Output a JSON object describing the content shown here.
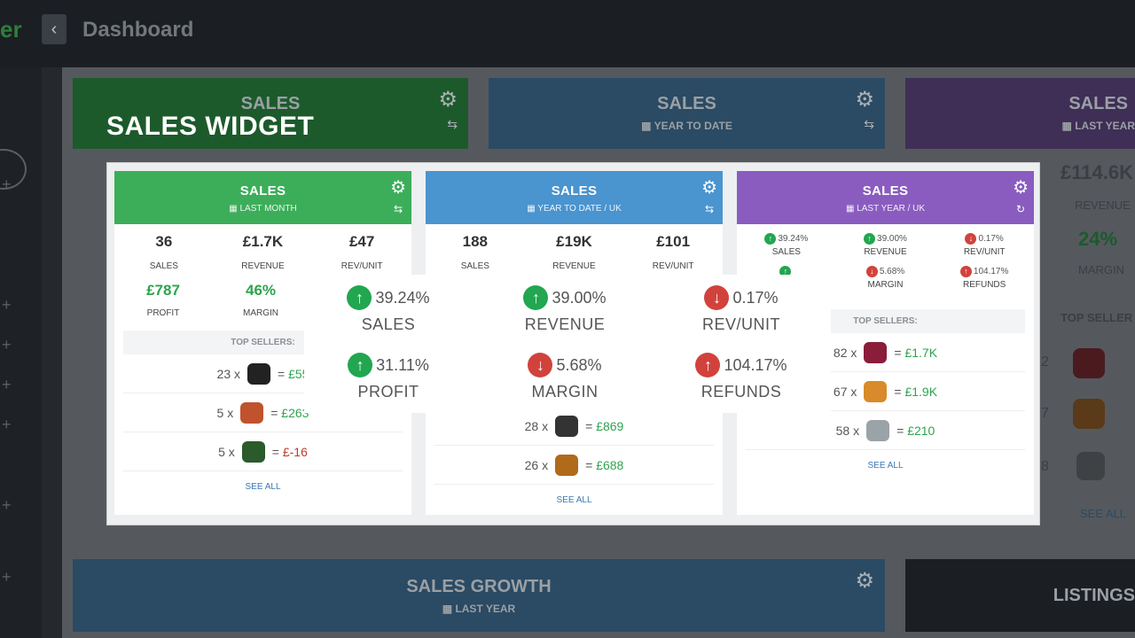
{
  "app": {
    "logo_text": "er",
    "page_title": "Dashboard",
    "back_icon": "‹"
  },
  "overlay_label": "SALES WIDGET",
  "bg_cards": [
    {
      "title": "SALES",
      "subtitle": ""
    },
    {
      "title": "SALES",
      "subtitle": "YEAR TO DATE"
    },
    {
      "title": "SALES",
      "subtitle": "LAST YEAR"
    }
  ],
  "bg_right": {
    "value": "£114.6K",
    "label1": "REVENUE",
    "pct": "24%",
    "label2": "MARGIN",
    "top_sellers": "TOP SELLER",
    "counts": [
      "2",
      "7",
      "8"
    ],
    "see_all": "SEE ALL"
  },
  "cards": [
    {
      "title": "SALES",
      "subtitle": "LAST MONTH",
      "color": "#3cae5a",
      "stats": [
        {
          "value": "36",
          "label": "SALES"
        },
        {
          "value": "£1.7K",
          "label": "REVENUE"
        },
        {
          "value": "£47",
          "label": "REV/UNIT"
        }
      ],
      "stats2": [
        {
          "value": "£787",
          "label": "PROFIT"
        },
        {
          "value": "46%",
          "label": "MARGIN"
        }
      ],
      "top_sellers_label": "TOP SELLERS:",
      "sellers": [
        {
          "qty": "23",
          "x": "x",
          "eq": "=",
          "amount": "£55"
        },
        {
          "qty": "5",
          "x": "x",
          "eq": "=",
          "amount": "£263"
        },
        {
          "qty": "5",
          "x": "x",
          "eq": "=",
          "amount": "£-16"
        }
      ],
      "see_all": "SEE ALL"
    },
    {
      "title": "SALES",
      "subtitle": "YEAR TO DATE  /  UK",
      "color": "#4a94cf",
      "stats": [
        {
          "value": "188",
          "label": "SALES"
        },
        {
          "value": "£19K",
          "label": "REVENUE"
        },
        {
          "value": "£101",
          "label": "REV/UNIT"
        }
      ],
      "sellers": [
        {
          "qty": "28",
          "x": "x",
          "eq": "=",
          "amount": "£869"
        },
        {
          "qty": "26",
          "x": "x",
          "eq": "=",
          "amount": "£688"
        }
      ],
      "see_all": "SEE ALL"
    },
    {
      "title": "SALES",
      "subtitle": "LAST YEAR  /  UK",
      "color": "#8a5cc0",
      "mini": [
        {
          "value": "39.24%",
          "label": "SALES",
          "dir": "up"
        },
        {
          "value": "39.00%",
          "label": "REVENUE",
          "dir": "up"
        },
        {
          "value": "0.17%",
          "label": "REV/UNIT",
          "dir": "down"
        },
        {
          "value": "",
          "label": "",
          "dir": "up"
        },
        {
          "value": "5.68%",
          "label": "MARGIN",
          "dir": "down"
        },
        {
          "value": "104.17%",
          "label": "REFUNDS",
          "dir": "up"
        }
      ],
      "top_sellers_label": "TOP SELLERS:",
      "sellers": [
        {
          "qty": "82",
          "x": "x",
          "eq": "=",
          "amount": "£1.7K"
        },
        {
          "qty": "67",
          "x": "x",
          "eq": "=",
          "amount": "£1.9K"
        },
        {
          "qty": "58",
          "x": "x",
          "eq": "=",
          "amount": "£210"
        }
      ],
      "see_all": "SEE ALL"
    }
  ],
  "popup": [
    {
      "value": "39.24%",
      "label": "SALES",
      "dir": "up",
      "arrow": "↑"
    },
    {
      "value": "39.00%",
      "label": "REVENUE",
      "dir": "up",
      "arrow": "↑"
    },
    {
      "value": "0.17%",
      "label": "REV/UNIT",
      "dir": "down",
      "arrow": "↓"
    },
    {
      "value": "31.11%",
      "label": "PROFIT",
      "dir": "up",
      "arrow": "↑"
    },
    {
      "value": "5.68%",
      "label": "MARGIN",
      "dir": "down",
      "arrow": "↓"
    },
    {
      "value": "104.17%",
      "label": "REFUNDS",
      "dir": "up",
      "arrow": "↑"
    }
  ],
  "bottom": {
    "growth_title": "SALES GROWTH",
    "growth_subtitle": "LAST YEAR",
    "listings": "LISTINGS"
  },
  "icons": {
    "gear": "⚙",
    "swap": "⇆",
    "refresh": "↻",
    "calendar": "▦",
    "plus": "+"
  }
}
